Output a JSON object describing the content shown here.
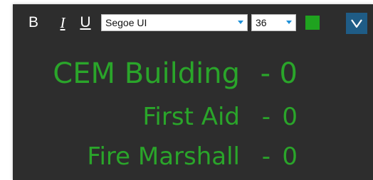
{
  "toolbar": {
    "bold_label": "B",
    "italic_label": "I",
    "underline_label": "U",
    "font_family": "Segoe UI",
    "font_size": "36",
    "text_color": "#1fa31f",
    "collapse_icon": "chevron-down-icon"
  },
  "colors": {
    "text": "#2aa52a",
    "background": "#2d2d2d",
    "accent": "#1e90d8"
  },
  "scores": [
    {
      "label": "CEM Building",
      "separator": "-",
      "value": "0"
    },
    {
      "label": "First Aid",
      "separator": "-",
      "value": "0"
    },
    {
      "label": "Fire Marshall",
      "separator": "-",
      "value": "0"
    }
  ]
}
